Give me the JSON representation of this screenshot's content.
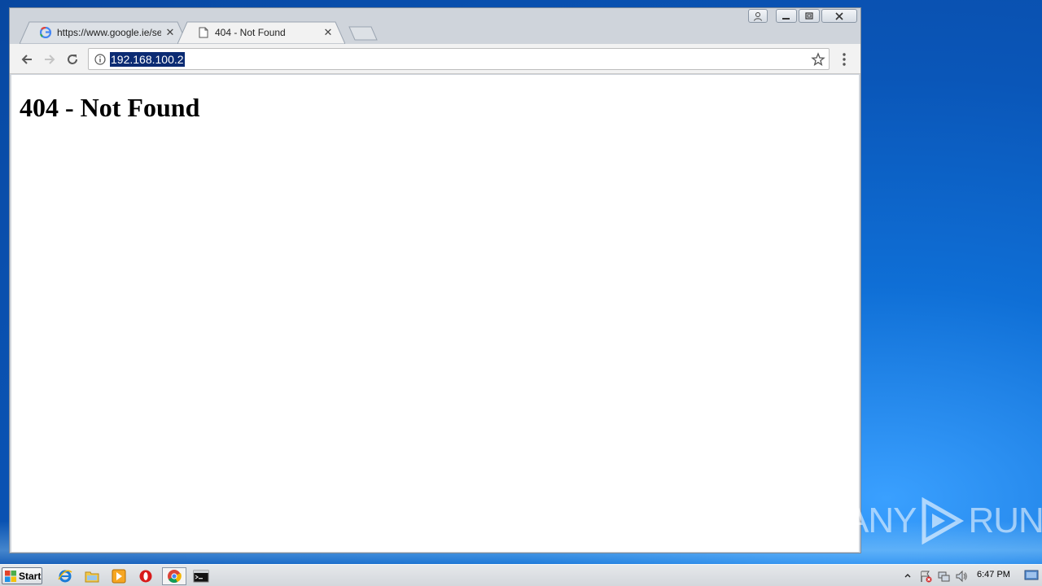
{
  "browser": {
    "tabs": [
      {
        "title": "https://www.google.ie/sear",
        "icon": "google-favicon",
        "active": false
      },
      {
        "title": "404 - Not Found",
        "icon": "page-icon",
        "active": true
      }
    ],
    "address": "192.168.100.2"
  },
  "page": {
    "heading": "404 - Not Found"
  },
  "watermark": {
    "left": "ANY",
    "right": "RUN"
  },
  "taskbar": {
    "start_label": "Start",
    "pinned": [
      "internet-explorer-icon",
      "file-explorer-icon",
      "media-player-icon",
      "opera-icon",
      "chrome-icon",
      "cmd-icon"
    ],
    "clock": "6:47 PM"
  },
  "colors": {
    "desktop": "#0a56b8",
    "url_selection": "#0b2b73"
  }
}
